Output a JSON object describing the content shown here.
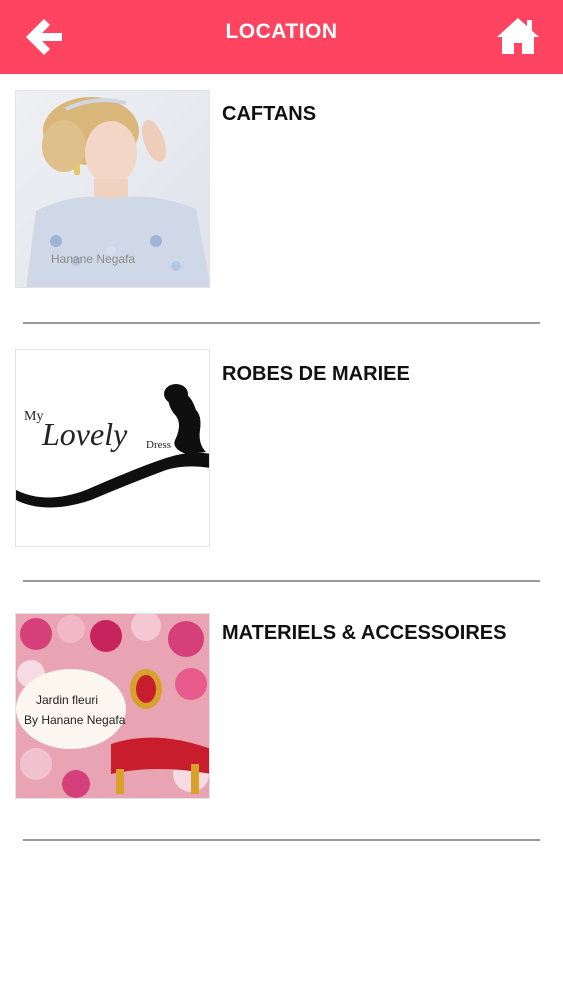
{
  "header": {
    "title": "LOCATION",
    "back_icon": "arrow-left-icon",
    "home_icon": "home-icon",
    "bar_color": "#fe4461"
  },
  "items": [
    {
      "label": "CAFTANS",
      "image": "bride-in-caftan-photo",
      "image_caption": "Hanane Negafa"
    },
    {
      "label": "ROBES DE MARIEE",
      "image": "my-lovely-dress-logo",
      "logo_text": {
        "my": "My",
        "lovely": "Lovely",
        "dress": "Dress"
      }
    },
    {
      "label": "MATERIELS & ACCESSOIRES",
      "image": "flower-garden-decor-photo",
      "image_caption_1": "Jardin fleuri",
      "image_caption_2": "By Hanane Negafa"
    }
  ]
}
